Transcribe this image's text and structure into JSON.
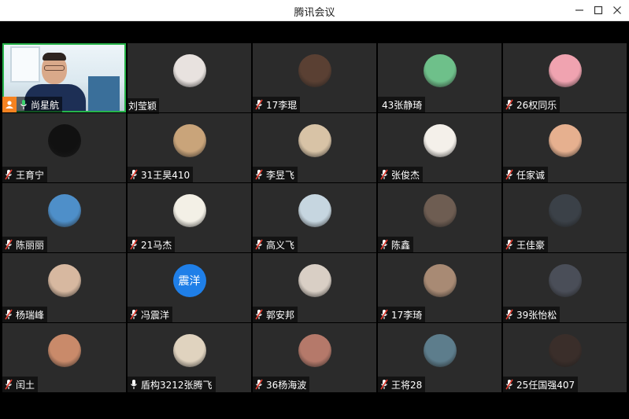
{
  "window": {
    "title": "腾讯会议"
  },
  "controls": {
    "minimize": "—",
    "maximize": "☐",
    "close": "✕"
  },
  "self_tile": {
    "name": "尚星航",
    "mic": "on"
  },
  "overflow_name": "刘莹颖",
  "participants": [
    {
      "name": "",
      "avatar": "avatar-mask",
      "color": "#e8e2df",
      "mic": "muted",
      "hide_plate": true
    },
    {
      "name": "17李琨",
      "avatar": "avatar-portrait",
      "color": "#5a4033",
      "mic": "muted"
    },
    {
      "name": "43张静琦",
      "avatar": "avatar-cartoon-girl",
      "color": "#6ec08a",
      "mic": "none"
    },
    {
      "name": "26权同乐",
      "avatar": "avatar-anime",
      "color": "#f0a3b0",
      "mic": "muted"
    },
    {
      "name": "王育宁",
      "avatar": "avatar-dark",
      "color": "#111111",
      "mic": "muted"
    },
    {
      "name": "31王昊410",
      "avatar": "avatar-dog",
      "color": "#c9a47a",
      "mic": "muted"
    },
    {
      "name": "李昱飞",
      "avatar": "avatar-character",
      "color": "#d8c3a6",
      "mic": "muted"
    },
    {
      "name": "张俊杰",
      "avatar": "avatar-cartoon-man",
      "color": "#f4f0ea",
      "mic": "muted"
    },
    {
      "name": "任家诚",
      "avatar": "avatar-kid",
      "color": "#e6b08f",
      "mic": "muted"
    },
    {
      "name": "陈丽丽",
      "avatar": "avatar-landscape",
      "color": "#4e8fc9",
      "mic": "muted"
    },
    {
      "name": "21马杰",
      "avatar": "avatar-pikachu",
      "color": "#f3f0e6",
      "mic": "muted"
    },
    {
      "name": "高义飞",
      "avatar": "avatar-sketch",
      "color": "#c6d6e0",
      "mic": "muted"
    },
    {
      "name": "陈鑫",
      "avatar": "avatar-animal",
      "color": "#6e5d52",
      "mic": "muted"
    },
    {
      "name": "王佳豪",
      "avatar": "avatar-figure",
      "color": "#3b4148",
      "mic": "muted"
    },
    {
      "name": "杨瑞峰",
      "avatar": "avatar-face",
      "color": "#d7b8a0",
      "mic": "muted"
    },
    {
      "name": "冯震洋",
      "avatar": "avatar-text",
      "color": "#1f7fe8",
      "text": "震洋",
      "mic": "muted"
    },
    {
      "name": "郭安邦",
      "avatar": "avatar-portrait-light",
      "color": "#d9cfc5",
      "mic": "muted"
    },
    {
      "name": "17李琦",
      "avatar": "avatar-couple",
      "color": "#a88a74",
      "mic": "muted"
    },
    {
      "name": "39张怡松",
      "avatar": "avatar-portrait-dark",
      "color": "#4a4e58",
      "mic": "muted"
    },
    {
      "name": "闰土",
      "avatar": "avatar-smile",
      "color": "#c98a6a",
      "mic": "muted"
    },
    {
      "name": "盾构3212张腾飞",
      "avatar": "avatar-hoodie",
      "color": "#e0d3bf",
      "mic": "on"
    },
    {
      "name": "36杨海波",
      "avatar": "avatar-sitting",
      "color": "#b5796a",
      "mic": "muted"
    },
    {
      "name": "王将28",
      "avatar": "avatar-night",
      "color": "#5d7d8c",
      "mic": "muted"
    },
    {
      "name": "25任国强407",
      "avatar": "avatar-man-dark",
      "color": "#3a2e2a",
      "mic": "muted"
    }
  ],
  "colors": {
    "accent_green": "#27b34a",
    "badge_orange": "#f58220",
    "tile_bg": "#2b2b2b",
    "muted_red": "#e43d30"
  }
}
